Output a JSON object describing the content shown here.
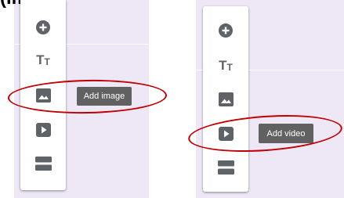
{
  "caption": "(Image)",
  "colors": {
    "panel_background": "#ede7f6",
    "toolbar_background": "#ffffff",
    "icon": "#5f6368",
    "tooltip_background": "#616161",
    "tooltip_text": "#ffffff",
    "annotation": "#c00000"
  },
  "left_toolbar": {
    "items": [
      {
        "icon": "add-circle-icon"
      },
      {
        "icon": "text-title-icon",
        "glyph_big": "T",
        "glyph_small": "T"
      },
      {
        "icon": "image-icon"
      },
      {
        "icon": "video-play-icon"
      },
      {
        "icon": "section-icon"
      }
    ],
    "tooltip": "Add image"
  },
  "right_toolbar": {
    "items": [
      {
        "icon": "add-circle-icon"
      },
      {
        "icon": "text-title-icon",
        "glyph_big": "T",
        "glyph_small": "T"
      },
      {
        "icon": "image-icon"
      },
      {
        "icon": "video-play-icon"
      },
      {
        "icon": "section-icon"
      }
    ],
    "tooltip": "Add video"
  }
}
